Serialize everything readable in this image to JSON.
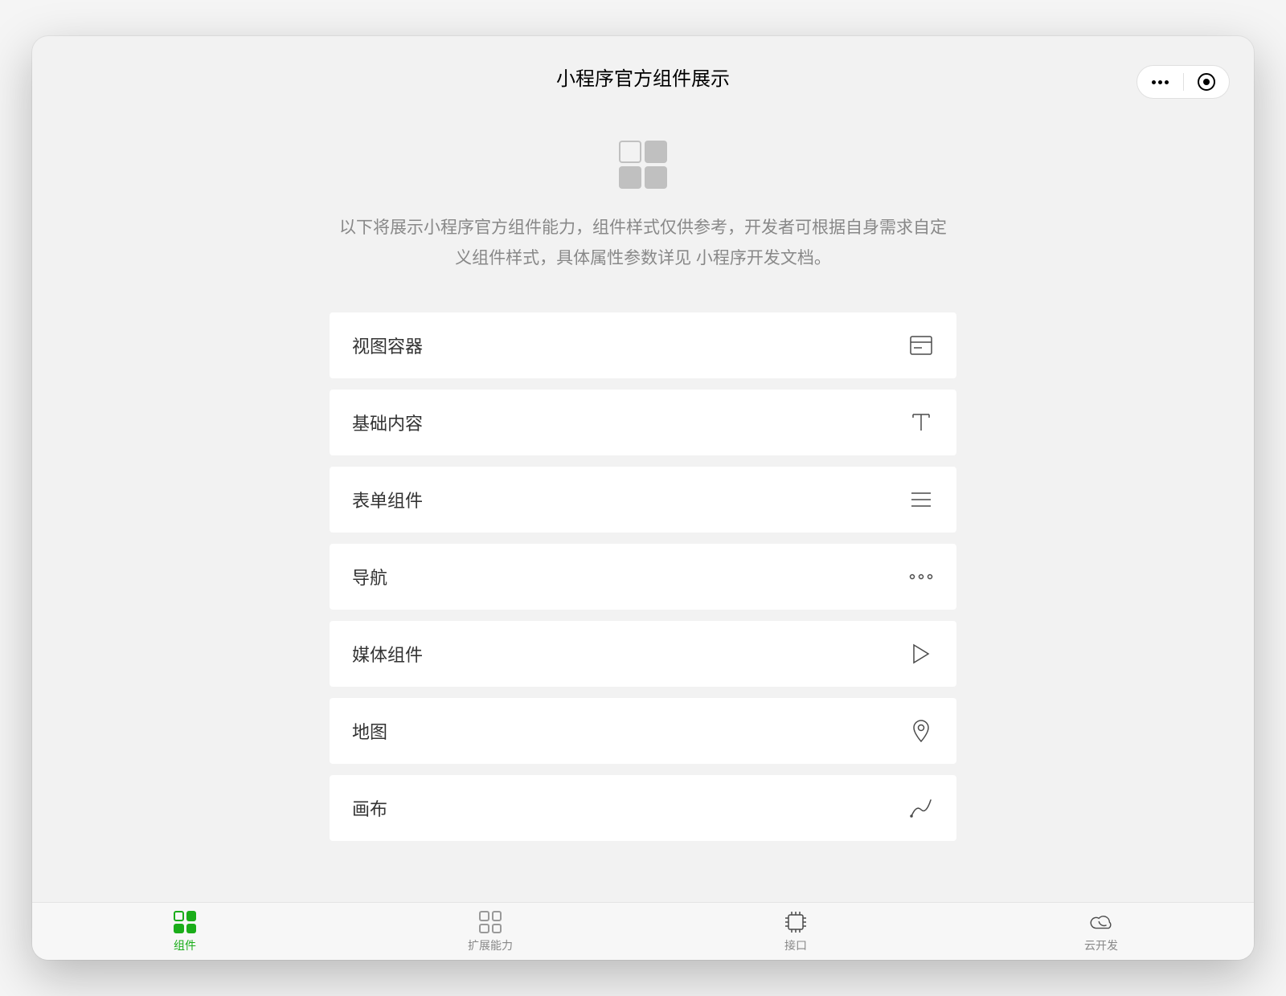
{
  "header": {
    "title": "小程序官方组件展示"
  },
  "intro": {
    "text": "以下将展示小程序官方组件能力，组件样式仅供参考，开发者可根据自身需求自定义组件样式，具体属性参数详见 小程序开发文档。"
  },
  "list": {
    "items": [
      {
        "label": "视图容器",
        "icon": "container-icon"
      },
      {
        "label": "基础内容",
        "icon": "text-icon"
      },
      {
        "label": "表单组件",
        "icon": "form-icon"
      },
      {
        "label": "导航",
        "icon": "nav-icon"
      },
      {
        "label": "媒体组件",
        "icon": "media-icon"
      },
      {
        "label": "地图",
        "icon": "map-icon"
      },
      {
        "label": "画布",
        "icon": "canvas-icon"
      }
    ]
  },
  "tabbar": {
    "items": [
      {
        "label": "组件",
        "icon": "components-tab-icon",
        "active": true
      },
      {
        "label": "扩展能力",
        "icon": "extension-tab-icon",
        "active": false
      },
      {
        "label": "接口",
        "icon": "api-tab-icon",
        "active": false
      },
      {
        "label": "云开发",
        "icon": "cloud-tab-icon",
        "active": false
      }
    ]
  },
  "colors": {
    "accent": "#1aad19",
    "muted": "#888888"
  }
}
